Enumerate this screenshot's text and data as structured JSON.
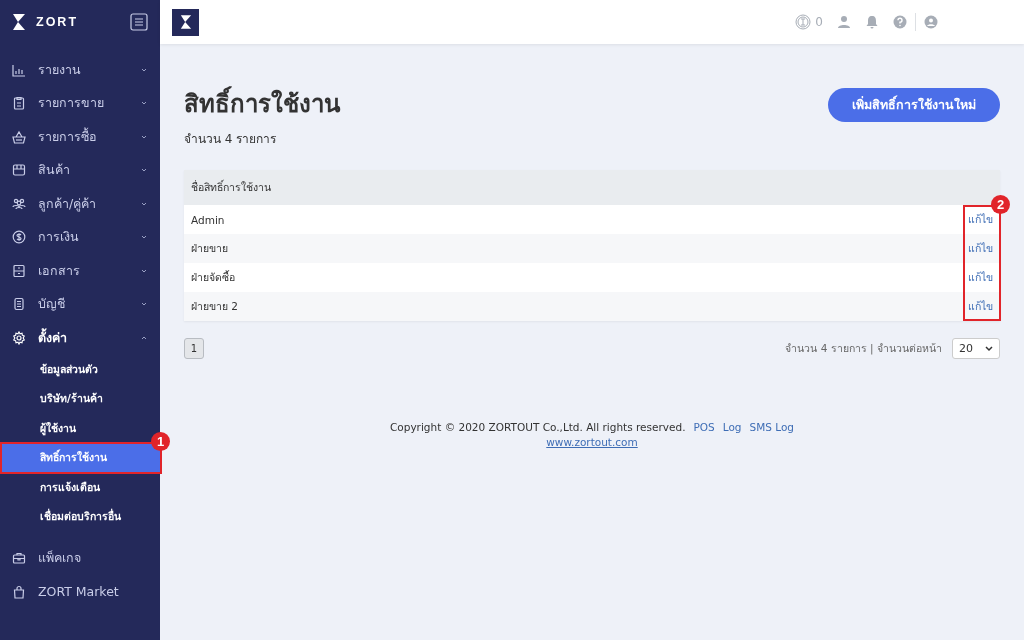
{
  "brand": {
    "name": "ZORT"
  },
  "sidebar": {
    "items": [
      {
        "label": "รายงาน",
        "expanded": false
      },
      {
        "label": "รายการขาย",
        "expanded": false
      },
      {
        "label": "รายการซื้อ",
        "expanded": false
      },
      {
        "label": "สินค้า",
        "expanded": false
      },
      {
        "label": "ลูกค้า/คู่ค้า",
        "expanded": false
      },
      {
        "label": "การเงิน",
        "expanded": false
      },
      {
        "label": "เอกสาร",
        "expanded": false
      },
      {
        "label": "บัญชี",
        "expanded": false
      },
      {
        "label": "ตั้งค่า",
        "expanded": true,
        "children": [
          {
            "label": "ข้อมูลส่วนตัว",
            "selected": false
          },
          {
            "label": "บริษัท/ร้านค้า",
            "selected": false
          },
          {
            "label": "ผู้ใช้งาน",
            "selected": false
          },
          {
            "label": "สิทธิ์การใช้งาน",
            "selected": true,
            "callout": "1"
          },
          {
            "label": "การแจ้งเตือน",
            "selected": false
          },
          {
            "label": "เชื่อมต่อบริการอื่น",
            "selected": false
          }
        ]
      }
    ],
    "bottom_items": [
      {
        "label": "แพ็คเกจ"
      },
      {
        "label": "ZORT Market"
      }
    ]
  },
  "topbar": {
    "counter": "0"
  },
  "page": {
    "title": "สิทธิ์การใช้งาน",
    "subtitle": "จำนวน 4 รายการ",
    "add_button": "เพิ่มสิทธิ์การใช้งานใหม่"
  },
  "table": {
    "columns": [
      "ชื่อสิทธิ์การใช้งาน"
    ],
    "edit_callout": "2",
    "rows": [
      {
        "name": "Admin",
        "action": "แก้ไข"
      },
      {
        "name": "ฝ่ายขาย",
        "action": "แก้ไข"
      },
      {
        "name": "ฝ่ายจัดซื้อ",
        "action": "แก้ไข"
      },
      {
        "name": "ฝ่ายขาย 2",
        "action": "แก้ไข"
      }
    ]
  },
  "pagination": {
    "pages": [
      {
        "label": "1"
      }
    ],
    "summary": "จำนวน 4 รายการ | จำนวนต่อหน้า",
    "per_page": "20"
  },
  "footer": {
    "copyright": "Copyright © 2020 ZORTOUT Co.,Ltd. All rights reserved.",
    "links": [
      "POS",
      "Log",
      "SMS Log"
    ],
    "website": "www.zortout.com"
  }
}
